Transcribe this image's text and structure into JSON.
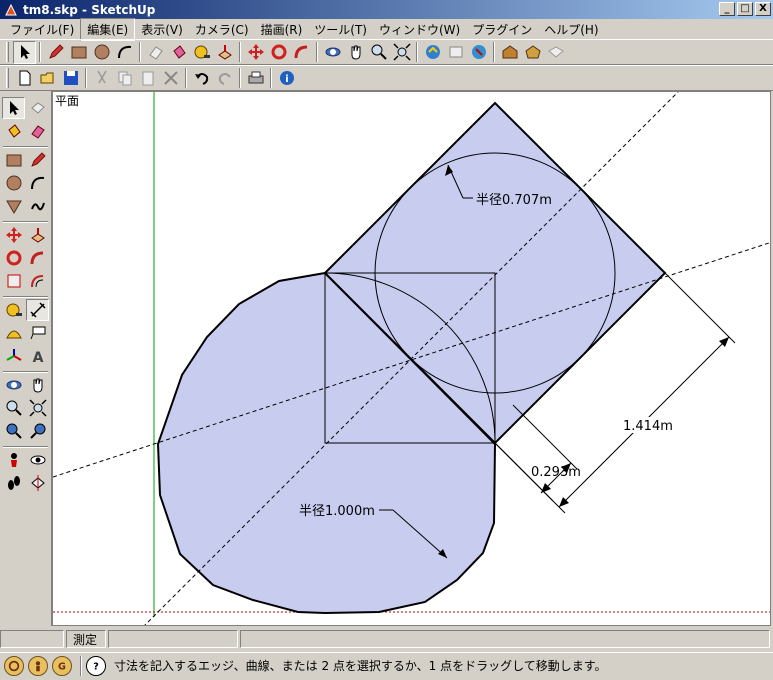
{
  "window": {
    "title": "tm8.skp - SketchUp",
    "minimize": "_",
    "maximize": "□",
    "close": "X"
  },
  "menu": [
    {
      "label": "ファイル(F)",
      "active": false
    },
    {
      "label": "編集(E)",
      "active": true
    },
    {
      "label": "表示(V)",
      "active": false
    },
    {
      "label": "カメラ(C)",
      "active": false
    },
    {
      "label": "描画(R)",
      "active": false
    },
    {
      "label": "ツール(T)",
      "active": false
    },
    {
      "label": "ウィンドウ(W)",
      "active": false
    },
    {
      "label": "プラグイン",
      "active": false
    },
    {
      "label": "ヘルプ(H)",
      "active": false
    }
  ],
  "toolbar1_icons": [
    "select-icon",
    "pencil-icon",
    "rectangle-icon",
    "circle-icon",
    "arc-icon",
    "eraser-icon",
    "paint-bucket-icon",
    "tape-measure-icon",
    "push-pull-icon",
    "move-icon",
    "rotate-icon",
    "follow-me-icon",
    "orbit-icon",
    "pan-icon",
    "zoom-icon",
    "zoom-extents-icon",
    "get-models-icon",
    "share-model-icon",
    "component-icon",
    "warehouse-icon",
    "ruby-icon",
    "plugin-icon"
  ],
  "toolbar2_icons": [
    "new-file-icon",
    "open-file-icon",
    "save-icon",
    "cut-icon",
    "copy-icon",
    "paste-icon",
    "delete-icon",
    "undo-icon",
    "redo-icon",
    "print-icon",
    "model-info-icon"
  ],
  "view": {
    "label": "平面",
    "dim_radius_small": "半径0.707m",
    "dim_radius_large": "半径1.000m",
    "dim_diagonal": "1.414m",
    "dim_offset": "0.293m",
    "face_color": "#c8cdf0",
    "edge_color": "#000000",
    "axis_green": "#00a000",
    "axis_red": "#c00000"
  },
  "measure": {
    "label": "測定",
    "value": ""
  },
  "status": {
    "message": "寸法を記入するエッジ、曲線、または 2 点を選択するか、1 点をドラッグして移動します。"
  }
}
